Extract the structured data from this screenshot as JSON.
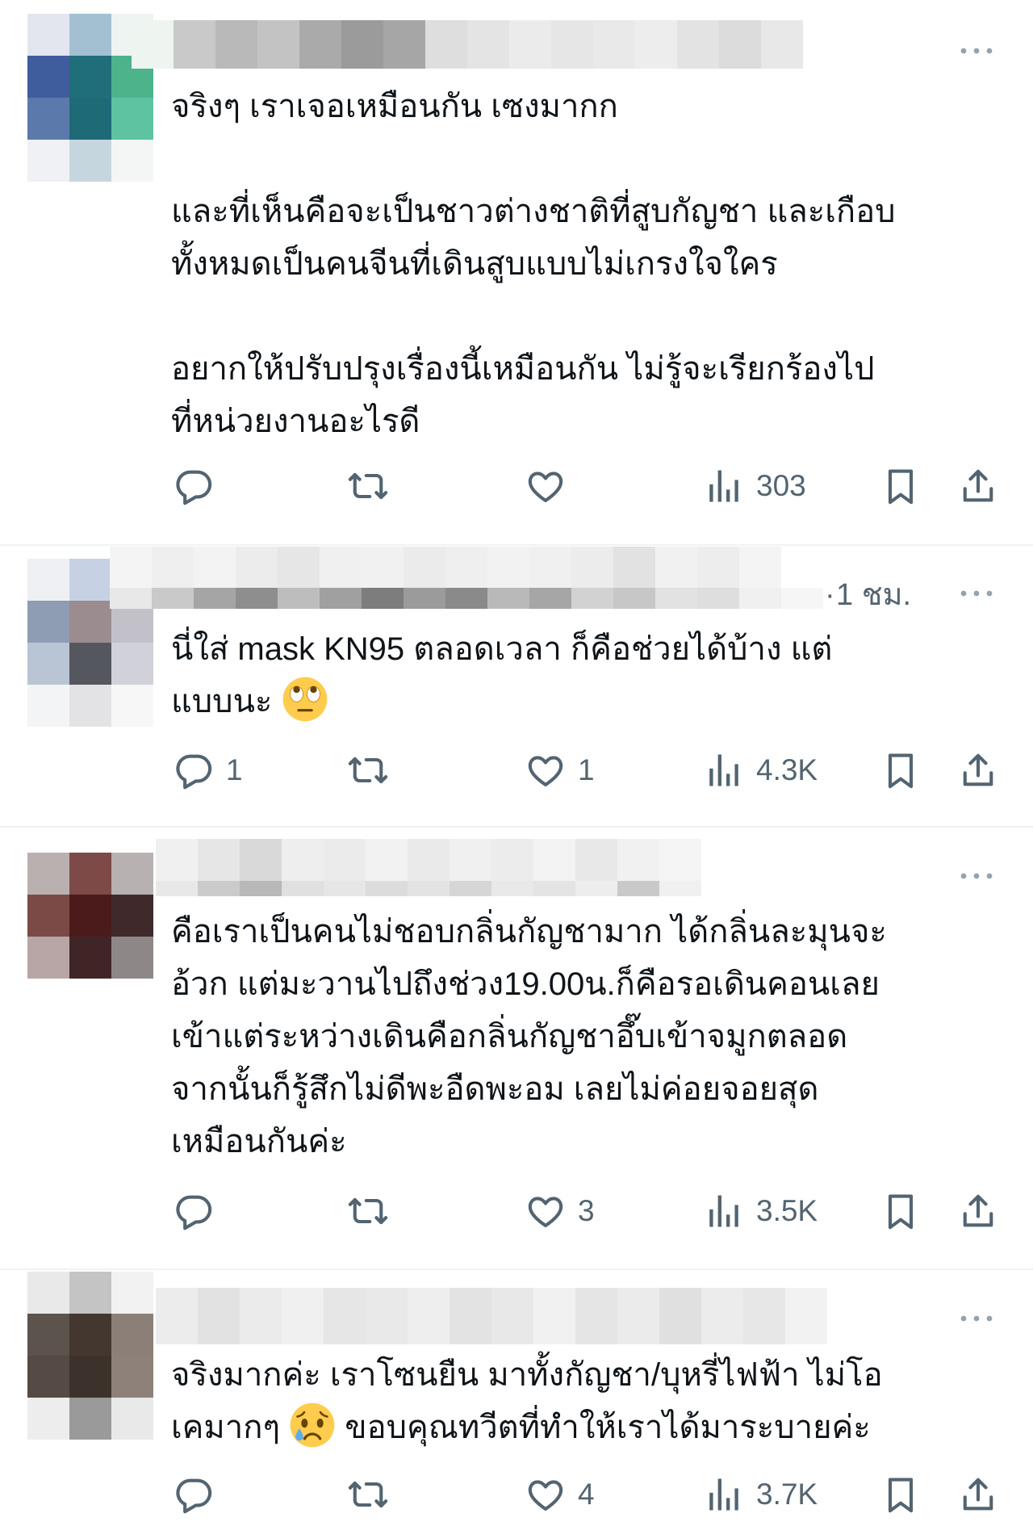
{
  "icons": {
    "reply": "reply-icon",
    "retweet": "retweet-icon",
    "like": "heart-icon",
    "views": "views-chart-icon",
    "bookmark": "bookmark-icon",
    "share": "share-icon",
    "more": "more-horizontal-icon"
  },
  "colors": {
    "text": "#0f1419",
    "secondary": "#536471",
    "divider": "#eff3f4"
  },
  "tweets": [
    {
      "avatar_pixels": [
        [
          "#e3e6ef",
          "#a3c0d3",
          "#eef4f2"
        ],
        [
          "#3f5c9c",
          "#1f6e79",
          "#4cb38b"
        ],
        [
          "#5b79aa",
          "#1e6a77",
          "#5ec3a0"
        ],
        [
          "#f0f1f5",
          "#c6d6df",
          "#f4f6f6"
        ]
      ],
      "name_blur": [
        [
          "#eef5f1",
          "#c9c9c9",
          "#b9b9b9",
          "#c3c3c3",
          "#aaaaaa",
          "#9b9b9b",
          "#a6a6a6",
          "#dedede",
          "#e4e4e4",
          "#ebebeb",
          "#e6e6e6",
          "#e9e9e9",
          "#ededed",
          "#e3e3e3",
          "#dcdcdc",
          "#e8e8e8"
        ]
      ],
      "paragraphs": [
        [
          "จริงๆ เราเจอเหมือนกัน เซงมากก"
        ],
        [
          "และที่เห็นคือจะเป็นชาวต่างชาติที่สูบกัญชา และเกือบ",
          "ทั้งหมดเป็นคนจีนที่เดินสูบแบบไม่เกรงใจใคร"
        ],
        [
          "อยากให้ปรับปรุงเรื่องนี้เหมือนกัน ไม่รู้จะเรียกร้องไป",
          "ที่หน่วยงานอะไรดี"
        ]
      ],
      "actions": {
        "views": "303"
      }
    },
    {
      "avatar_pixels": [
        [
          "#eef0f4",
          "#c6d2e3",
          "#f2f3f6"
        ],
        [
          "#8f9db4",
          "#9b8c90",
          "#c2c1ca"
        ],
        [
          "#b9c4d4",
          "#55575f",
          "#d0d1d9"
        ],
        [
          "#f3f4f6",
          "#e3e3e5",
          "#f7f7f8"
        ]
      ],
      "name_blur": [
        [
          "#f4f4f4",
          "#efefef",
          "#f3f3f3",
          "#ececec",
          "#e6e6e6",
          "#f0f0f0",
          "#f1f1f1",
          "#ebebeb",
          "#efefef",
          "#f2f2f2",
          "#f0f0f0",
          "#ececec",
          "#e2e2e2",
          "#f1f1f1",
          "#ededed",
          "#f4f4f4"
        ],
        [
          "#e8e8e8",
          "#c9c9c9",
          "#a5a5a5",
          "#8e8e8e",
          "#bdbdbd",
          "#a0a0a0",
          "#7d7d7d",
          "#9b9b9b",
          "#8a8a8a",
          "#b9b9b9",
          "#a6a6a6",
          "#d2d2d2",
          "#c7c7c7",
          "#e2e2e2",
          "#dedede",
          "#f0f0f0",
          "#f6f6f6"
        ]
      ],
      "time_separator": "·",
      "time": "1 ชม.",
      "paragraphs": [
        [
          "นี่ใส่ mask KN95 ตลอดเวลา ก็คือช่วยได้บ้าง แต่",
          {
            "before": "แบบนะ",
            "emoji": "face-with-rolling-eyes"
          }
        ]
      ],
      "actions": {
        "replies": "1",
        "likes": "1",
        "views": "4.3K"
      }
    },
    {
      "avatar_pixels": [
        [
          "#bbb0b0",
          "#7d4a47",
          "#b7b1b1"
        ],
        [
          "#7b4a46",
          "#4b1b1b",
          "#40292a"
        ],
        [
          "#b8a6a6",
          "#402527",
          "#8e8787"
        ]
      ],
      "name_blur": [
        [
          "#f0f0f0",
          "#e6e6e6",
          "#d9d9d9",
          "#eeeeee",
          "#ebebeb",
          "#f2f2f2",
          "#eaeaea",
          "#f0f0f0",
          "#ececec",
          "#f3f3f3",
          "#e8e8e8",
          "#f1f1f1",
          "#f5f5f5"
        ],
        [
          "#e8e8e8",
          "#cbcbcb",
          "#b8b8b8",
          "#e0e0e0",
          "#e6e6e6",
          "#dcdcdc",
          "#e3e3e3",
          "#d6d6d6",
          "#e9e9e9",
          "#e4e4e4",
          "#ededed",
          "#c9c9c9",
          "#f0f0f0"
        ]
      ],
      "paragraphs": [
        [
          "คือเราเป็นคนไม่ชอบกลิ่นกัญชามาก ได้กลิ่นละมุนจะ",
          "อ้วก แต่มะวานไปถึงช่วง19.00น.ก็คือรอเดินคอนเลย",
          "เข้าแต่ระหว่างเดินคือกลิ่นกัญชาอึ๊บเข้าจมูกตลอด",
          "จากนั้นก็รู้สึกไม่ดีพะอืดพะอม เลยไม่ค่อยจอยสุด",
          "เหมือนกันค่ะ"
        ]
      ],
      "actions": {
        "likes": "3",
        "views": "3.5K"
      }
    },
    {
      "avatar_pixels": [
        [
          "#e9e9e9",
          "#c4c4c4",
          "#f2f2f2"
        ],
        [
          "#5c534d",
          "#43372f",
          "#8b7f77"
        ],
        [
          "#564a44",
          "#3c312b",
          "#8e817a"
        ],
        [
          "#ededed",
          "#9b9a9a",
          "#e9e9e9"
        ]
      ],
      "name_blur": [
        [
          "#ececec",
          "#e2e2e2",
          "#ebebeb",
          "#f0f0f0",
          "#e6e6e6",
          "#e9e9e9",
          "#eeeeee",
          "#e3e3e3",
          "#e8e8e8",
          "#f1f1f1",
          "#e5e5e5",
          "#ebebeb",
          "#e0e0e0",
          "#ececec",
          "#e7e7e7",
          "#f2f2f2"
        ]
      ],
      "paragraphs": [
        [
          "จริงมากค่ะ เราโซนยืน มาทั้งกัญชา/บุหรี่ไฟฟ้า ไม่โอ",
          {
            "before": "เคมากๆ",
            "emoji": "crying-face",
            "after": "ขอบคุณทวีตที่ทำให้เราได้มาระบายค่ะ"
          }
        ]
      ],
      "actions": {
        "likes": "4",
        "views": "3.7K"
      }
    }
  ]
}
